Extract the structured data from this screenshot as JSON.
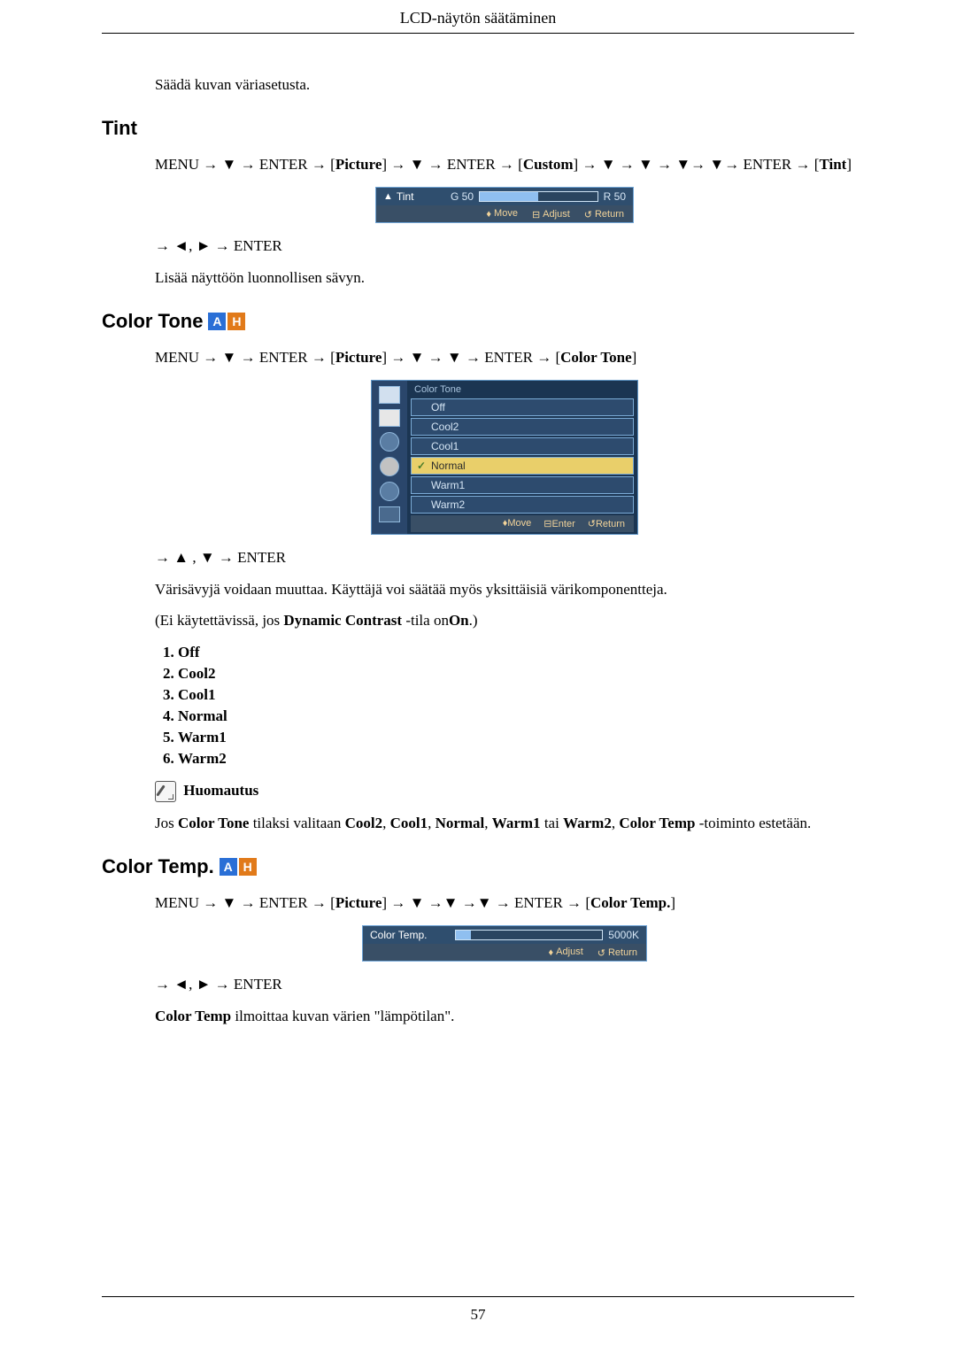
{
  "header": {
    "title": "LCD-näytön säätäminen"
  },
  "intro": "Säädä kuvan väriasetusta.",
  "tint": {
    "title": "Tint",
    "path_pre": "MENU → ▼ → ENTER → ",
    "picture": "Picture",
    "path_mid": " → ▼ → ENTER → ",
    "custom": "Custom",
    "path_post": " → ▼ → ▼ → ▼→ ▼→ ENTER → ",
    "tint_bracket": "Tint",
    "osd": {
      "label": "Tint",
      "g": "G 50",
      "r": "R 50",
      "move": "Move",
      "adjust": "Adjust",
      "return": "Return"
    },
    "after_enter": "→ ◄, ► → ENTER",
    "desc": "Lisää näyttöön luonnollisen sävyn."
  },
  "ctone": {
    "title": "Color Tone",
    "path_pre": "MENU → ▼ → ENTER → ",
    "picture": "Picture",
    "path_mid": " → ▼ → ▼ → ENTER → ",
    "tone_bracket": "Color Tone",
    "osd": {
      "title": "Color Tone",
      "items": [
        "Off",
        "Cool2",
        "Cool1",
        "Normal",
        "Warm1",
        "Warm2"
      ],
      "move": "Move",
      "enter": "Enter",
      "return": "Return"
    },
    "after_enter": "→ ▲ , ▼ → ENTER",
    "desc": "Värisävyjä voidaan muuttaa. Käyttäjä voi säätää myös yksittäisiä värikomponentteja.",
    "dynamic_pre": "(Ei käytettävissä, jos ",
    "dynamic_bold": "Dynamic Contrast",
    "dynamic_mid": " -tila on",
    "dynamic_on": "On",
    "dynamic_post": ".)",
    "list": [
      "Off",
      "Cool2",
      "Cool1",
      "Normal",
      "Warm1",
      "Warm2"
    ],
    "note_label": "Huomautus",
    "note_pre": "Jos ",
    "note_ct": "Color Tone",
    "note_mid1": " tilaksi valitaan ",
    "note_c2": "Cool2",
    "note_c1": "Cool1",
    "note_n": "Normal",
    "note_w1": "Warm1",
    "note_or": " tai ",
    "note_w2": "Warm2",
    "note_sep": ", ",
    "note_temp": "Color Temp",
    "note_post": " -toiminto estetään."
  },
  "ctemp": {
    "title": "Color Temp.",
    "path_pre": "MENU → ▼ → ENTER → ",
    "picture": "Picture",
    "path_mid": " → ▼ →▼ →▼ → ENTER → ",
    "temp_bracket": "Color Temp.",
    "osd": {
      "label": "Color Temp.",
      "value": "5000K",
      "adjust": "Adjust",
      "return": "Return"
    },
    "after_enter": "→ ◄, ► → ENTER",
    "desc_bold": "Color Temp",
    "desc_rest": " ilmoittaa kuvan värien \"lämpötilan\"."
  },
  "page_number": "57"
}
